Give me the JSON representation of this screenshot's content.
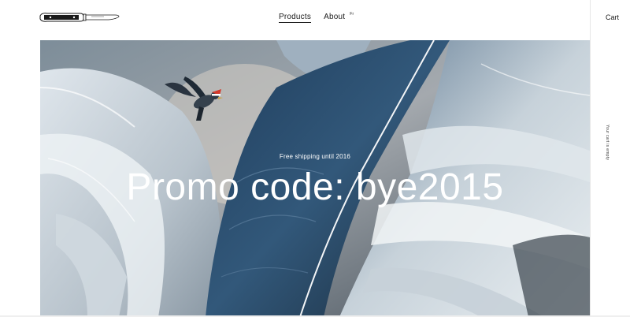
{
  "header": {
    "logo_icon": "knife-logo-icon",
    "nav": {
      "products": "Products",
      "about": "About",
      "lang": "Fr"
    }
  },
  "cart": {
    "label": "Cart",
    "empty_text": "Your cart is empty"
  },
  "hero": {
    "subtitle": "Free shipping until 2016",
    "title": "Promo code: bye2015",
    "image_icon": "bird-feathers-image"
  },
  "colors": {
    "text": "#1a1a1a",
    "hero_text": "#ffffff",
    "feather_blue": "#2f4f6e",
    "feather_light": "#c9d3dc",
    "hat_red": "#d33a2c"
  }
}
